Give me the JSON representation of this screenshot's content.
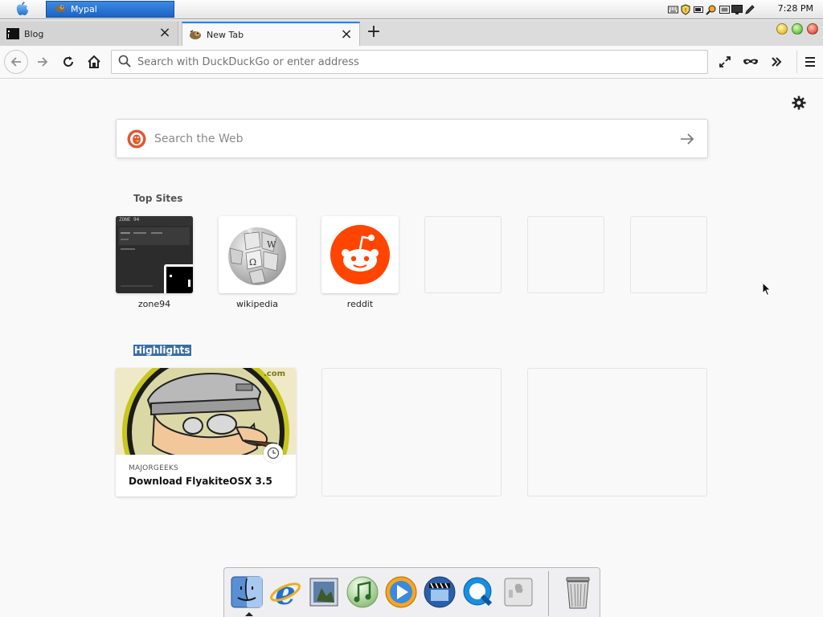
{
  "menubar": {
    "task_title": "Mypal",
    "clock": "7:28 PM",
    "tray_icons": [
      "keyboard-icon",
      "shield-icon",
      "battery-icon",
      "search-icon",
      "display-icon",
      "monitor-icon",
      "pen-icon"
    ]
  },
  "tabs": [
    {
      "label": "Blog",
      "icon": "terminal-favicon-icon",
      "active": false
    },
    {
      "label": "New Tab",
      "icon": "mypal-favicon-icon",
      "active": true
    }
  ],
  "toolbar": {
    "address_placeholder": "Search with DuckDuckGo or enter address"
  },
  "newtab": {
    "search_placeholder": "Search the Web",
    "top_sites_title": "Top Sites",
    "top_sites": [
      {
        "label": "zone94"
      },
      {
        "label": "wikipedia"
      },
      {
        "label": "reddit"
      },
      {
        "label": ""
      },
      {
        "label": ""
      },
      {
        "label": ""
      }
    ],
    "highlights_title": "Highlights",
    "highlight": {
      "source": "MAJORGEEKS",
      "title": "Download FlyakiteOSX 3.5",
      "image_text": ".com"
    },
    "zone94_thumb_text": "ZONE 94"
  },
  "dock": {
    "items": [
      "finder-icon",
      "internet-explorer-icon",
      "preview-icon",
      "itunes-icon",
      "media-player-icon",
      "video-icon",
      "dvd-player-icon",
      "quicktime-icon",
      "system-preferences-icon",
      "trash-icon"
    ]
  },
  "colors": {
    "accent": "#0a84ff",
    "reddit": "#ff4500",
    "ddg": "#de5833",
    "selection": "#3b6ea5"
  }
}
